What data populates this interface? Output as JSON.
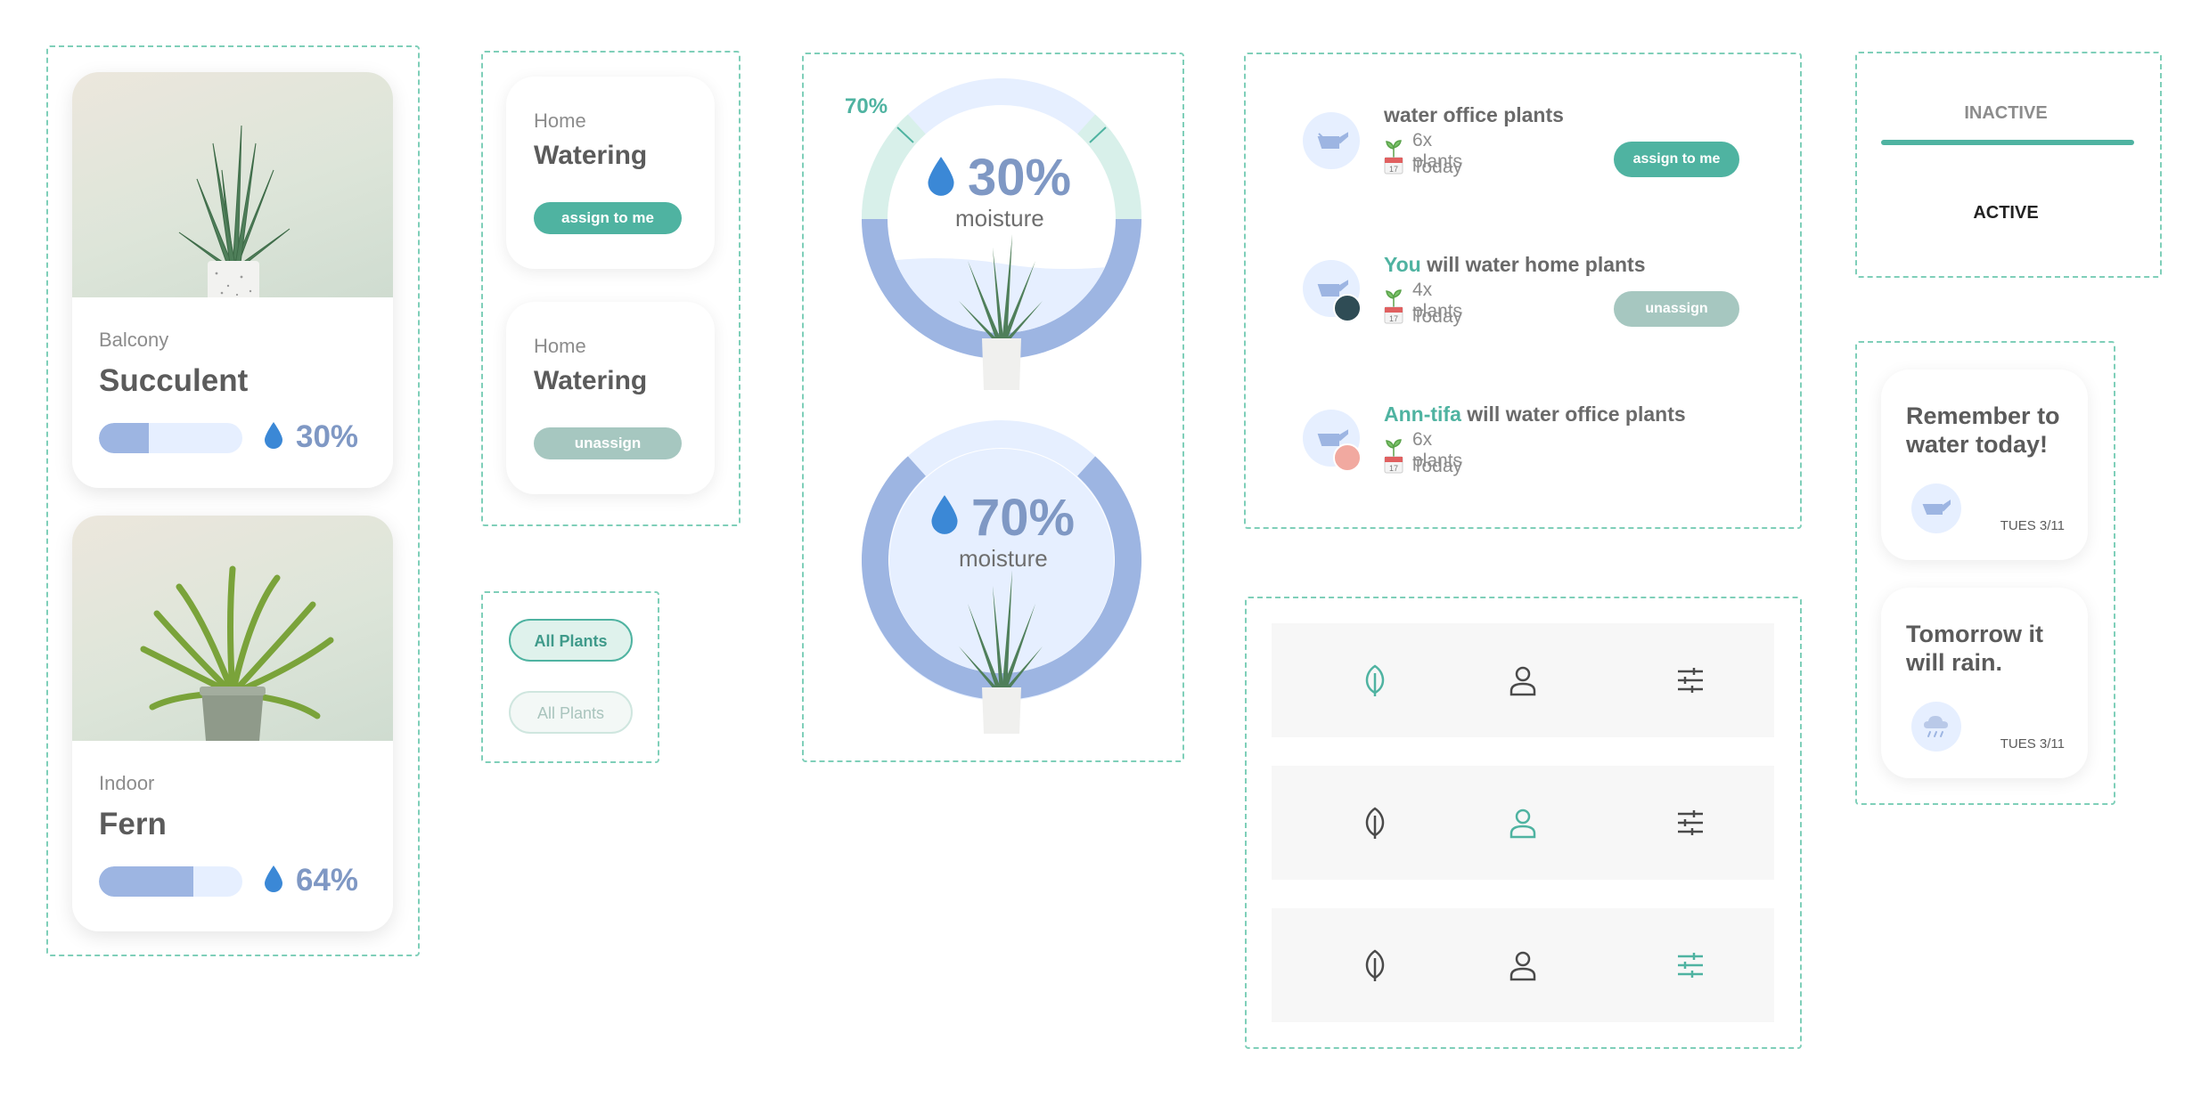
{
  "plants": [
    {
      "room": "Balcony",
      "name": "Succulent",
      "moisture": "30%",
      "fill": 0.35
    },
    {
      "room": "Indoor",
      "name": "Fern",
      "moisture": "64%",
      "fill": 0.66
    }
  ],
  "watering_cards": [
    {
      "room": "Home",
      "title": "Watering",
      "button": "assign to me"
    },
    {
      "room": "Home",
      "title": "Watering",
      "button": "unassign"
    }
  ],
  "chips": {
    "active": "All Plants",
    "inactive": "All Plants"
  },
  "gauges": [
    {
      "target_label": "70%",
      "percent": "30%",
      "label": "moisture"
    },
    {
      "percent": "70%",
      "label": "moisture"
    }
  ],
  "tasks": [
    {
      "highlight": "",
      "title": "water office plants",
      "plants": "6x plants",
      "date": "Today",
      "button": "assign to me"
    },
    {
      "highlight": "You",
      "title": " will water home plants",
      "plants": "4x plants",
      "date": "Today",
      "button": "unassign"
    },
    {
      "highlight": "Ann-tifa",
      "title": " will water office plants",
      "plants": "6x plants",
      "date": "Today",
      "button": ""
    }
  ],
  "calendar_day": "17",
  "nav_states": [
    {
      "selected": "leaf"
    },
    {
      "selected": "person"
    },
    {
      "selected": "sliders"
    }
  ],
  "tabs": {
    "inactive": "INACTIVE",
    "active": "ACTIVE"
  },
  "reminders": [
    {
      "message": "Remember to water today!",
      "date": "TUES 3/11",
      "icon": "watering-can-icon"
    },
    {
      "message": "Tomorrow it will rain.",
      "date": "TUES 3/11",
      "icon": "rain-cloud-icon"
    }
  ],
  "colors": {
    "accent": "#4fb3a1",
    "moisture": "#9db5e2",
    "moisture_light": "#e6efff",
    "dash": "#7fcfb9"
  }
}
